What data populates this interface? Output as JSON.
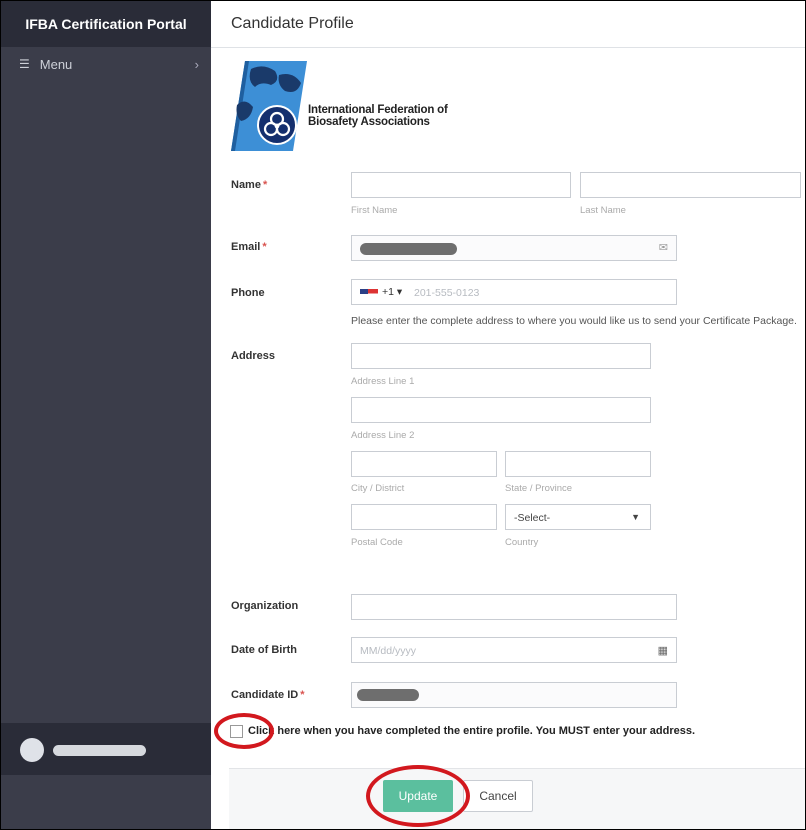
{
  "sidebar": {
    "brand": "IFBA Certification Portal",
    "menu_label": "Menu"
  },
  "header": {
    "title": "Candidate Profile"
  },
  "logo": {
    "line1": "International Federation of",
    "line2": "Biosafety Associations"
  },
  "form": {
    "name": {
      "label": "Name",
      "first_caption": "First Name",
      "last_caption": "Last Name"
    },
    "email": {
      "label": "Email"
    },
    "phone": {
      "label": "Phone",
      "country_code": "+1 ▾",
      "placeholder": "201-555-0123"
    },
    "address_hint": "Please enter the complete address to where you would like us to send your Certificate Package.",
    "address": {
      "label": "Address",
      "line1_caption": "Address Line 1",
      "line2_caption": "Address Line 2",
      "city_caption": "City / District",
      "state_caption": "State / Province",
      "postal_caption": "Postal Code",
      "country_caption": "Country",
      "country_value": "-Select-"
    },
    "organization": {
      "label": "Organization"
    },
    "dob": {
      "label": "Date of Birth",
      "placeholder": "MM/dd/yyyy"
    },
    "candidate_id": {
      "label": "Candidate ID"
    },
    "required_marker": "*"
  },
  "completion": {
    "text": "Click here when you have completed the entire profile. You MUST enter your address."
  },
  "actions": {
    "update": "Update",
    "cancel": "Cancel"
  },
  "colors": {
    "sidebar": "#3b3d4a",
    "accent": "#5bbf9e",
    "highlight_ring": "#d2181e"
  }
}
